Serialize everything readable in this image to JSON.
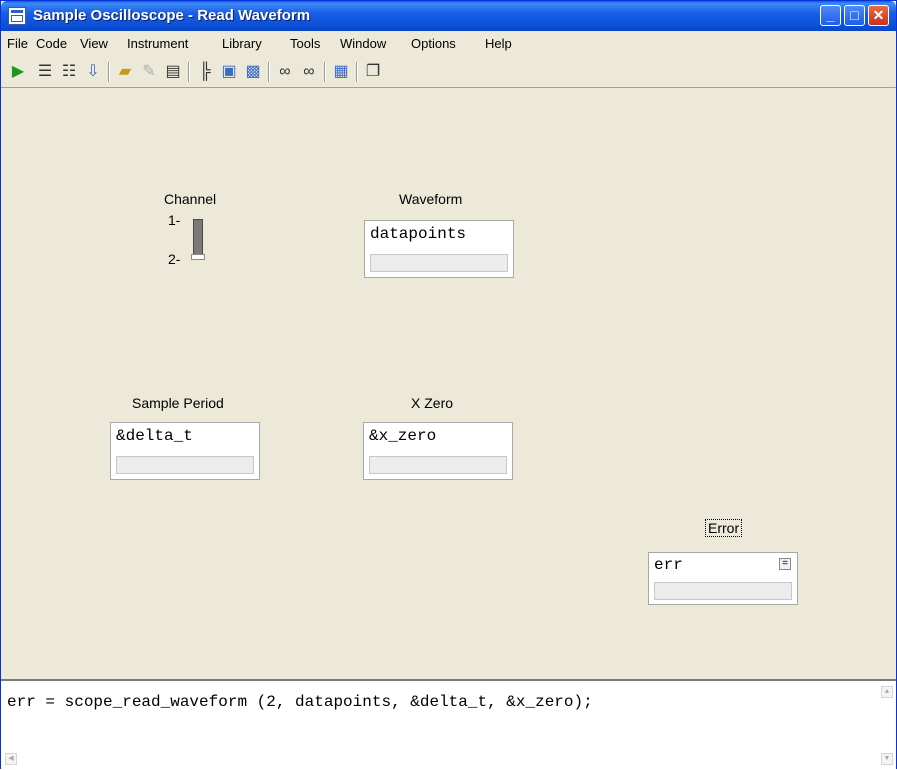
{
  "window": {
    "title": "Sample Oscilloscope - Read Waveform",
    "buttons": {
      "minimize": "_",
      "maximize": "□",
      "close": "✕"
    }
  },
  "menu": [
    "File",
    "Code",
    "View",
    "Instrument",
    "Library",
    "Tools",
    "Window",
    "Options",
    "Help"
  ],
  "toolbar": {
    "icons": [
      "run-icon",
      "insert-function-icon",
      "new-function-icon",
      "select-variable-icon",
      "open-icon",
      "edit-icon",
      "find-icon",
      "tree-icon",
      "recall-icon",
      "save-icon",
      "watch-icon",
      "watch-expression-icon",
      "panel-icon",
      "copy-icon"
    ]
  },
  "controls": {
    "channel": {
      "label": "Channel",
      "tick_top": "1-",
      "tick_bottom": "2-",
      "selected": "2"
    },
    "waveform": {
      "label": "Waveform",
      "value": "datapoints"
    },
    "sample_period": {
      "label": "Sample Period",
      "value": "&delta_t"
    },
    "x_zero": {
      "label": "X Zero",
      "value": "&x_zero"
    },
    "error": {
      "label": "Error",
      "value": "err",
      "button": "="
    }
  },
  "code": {
    "line": "err = scope_read_waveform (2, datapoints, &delta_t, &x_zero);"
  }
}
